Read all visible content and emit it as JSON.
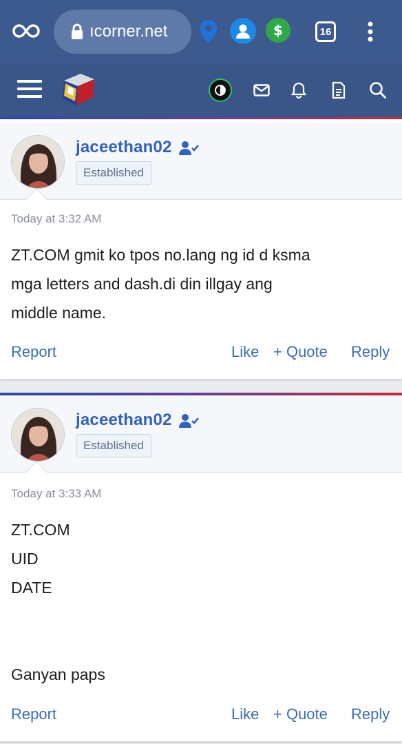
{
  "browser": {
    "url": "ıcorner.net",
    "tab_count": "16"
  },
  "colors": {
    "chrome_bg": "#3d5a8f",
    "header_bg": "#3a5689",
    "link": "#3c6cb4",
    "username": "#3363b8"
  },
  "posts": [
    {
      "username": "jaceethan02",
      "user_title": "Established",
      "date": "Today at 3:32 AM",
      "body_lines": [
        "ZT.COM gmit ko tpos no.lang ng id d ksma",
        "mga letters and dash.di din illgay ang",
        "middle name."
      ],
      "actions": {
        "report": "Report",
        "like": "Like",
        "quote": "+ Quote",
        "reply": "Reply"
      }
    },
    {
      "username": "jaceethan02",
      "user_title": "Established",
      "date": "Today at 3:33 AM",
      "body_lines": [
        "ZT.COM",
        "UID",
        "DATE",
        "",
        "",
        "Ganyan paps"
      ],
      "actions": {
        "report": "Report",
        "like": "Like",
        "quote": "+ Quote",
        "reply": "Reply"
      }
    }
  ]
}
